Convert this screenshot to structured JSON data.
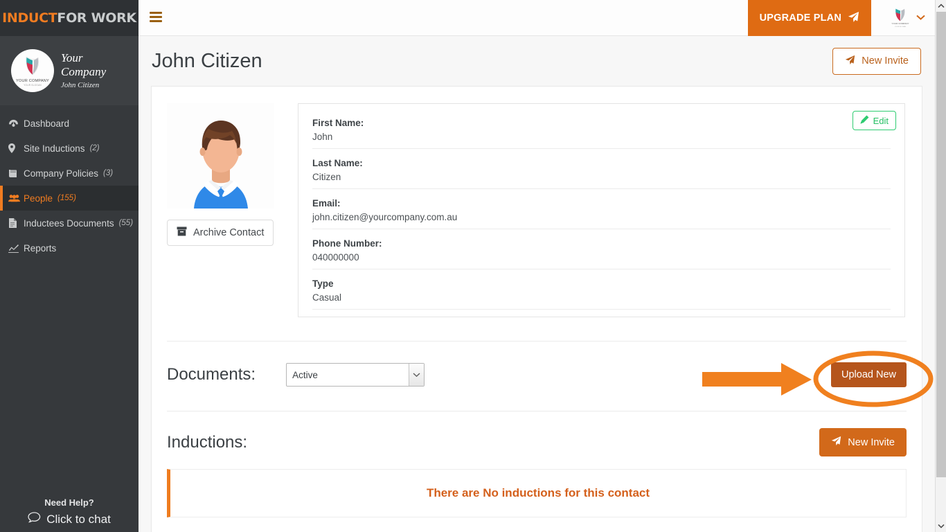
{
  "brand": {
    "part1": "INDUCT",
    "part2": "FOR WORK"
  },
  "sidebar": {
    "company": {
      "name": "Your Company",
      "user": "John Citizen",
      "logo_line1": "YOUR COMPANY",
      "logo_line2": "YOUR SLOGAN",
      "logo_icon": "company-shield-logo"
    },
    "items": [
      {
        "label": "Dashboard",
        "count": "",
        "icon": "dashboard-icon",
        "active": false
      },
      {
        "label": "Site Inductions",
        "count": "(2)",
        "icon": "map-pin-icon",
        "active": false
      },
      {
        "label": "Company Policies",
        "count": "(3)",
        "icon": "book-icon",
        "active": false
      },
      {
        "label": "People",
        "count": "(155)",
        "icon": "people-icon",
        "active": true
      },
      {
        "label": "Inductees Documents",
        "count": "(55)",
        "icon": "document-icon",
        "active": false
      },
      {
        "label": "Reports",
        "count": "",
        "icon": "chart-line-icon",
        "active": false
      }
    ],
    "help": {
      "title": "Need Help?",
      "chat_label": "Click to chat",
      "chat_icon": "chat-bubble-icon"
    }
  },
  "topbar": {
    "menu_icon": "hamburger-menu-icon",
    "upgrade_label": "UPGRADE PLAN",
    "upgrade_icon": "paper-plane-icon",
    "user_avatar_icon": "company-shield-logo",
    "user_chevron_icon": "chevron-down-icon"
  },
  "page": {
    "title": "John Citizen",
    "new_invite_label": "New Invite",
    "new_invite_icon": "paper-plane-icon"
  },
  "profile": {
    "avatar_icon": "user-photo-placeholder",
    "archive_label": "Archive Contact",
    "archive_icon": "archive-box-icon",
    "edit_label": "Edit",
    "edit_icon": "pencil-icon",
    "fields": [
      {
        "label": "First Name:",
        "value": "John"
      },
      {
        "label": "Last Name:",
        "value": "Citizen"
      },
      {
        "label": "Email:",
        "value": "john.citizen@yourcompany.com.au"
      },
      {
        "label": "Phone Number:",
        "value": "040000000"
      },
      {
        "label": "Type",
        "value": "Casual"
      }
    ]
  },
  "documents": {
    "heading": "Documents:",
    "filter_selected": "Active",
    "filter_options": [
      "Active"
    ],
    "filter_icon": "chevron-down-icon",
    "upload_label": "Upload New"
  },
  "inductions": {
    "heading": "Inductions:",
    "new_invite_label": "New Invite",
    "new_invite_icon": "paper-plane-icon",
    "empty_message": "There are No inductions for this contact"
  },
  "annotations": {
    "highlight_ellipse": "orange-ellipse-around-upload-new",
    "pointer_arrow": "orange-arrow-pointing-right",
    "color": "#f0801f"
  },
  "colors": {
    "accent_orange": "#f07c21",
    "upgrade_orange": "#df6b13",
    "upload_brown": "#b5551c",
    "sidebar_bg": "#36393c",
    "edit_green": "#2ecc71",
    "alert_orange": "#d4601c"
  },
  "scrollbar": {
    "up_icon": "chevron-up-icon",
    "down_icon": "chevron-down-icon"
  }
}
